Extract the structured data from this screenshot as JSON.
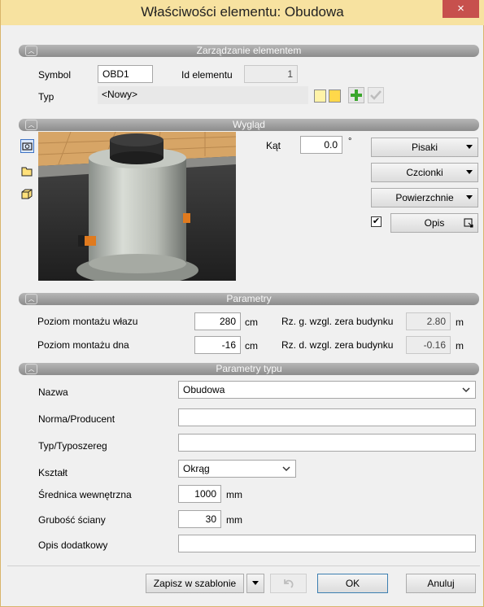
{
  "window": {
    "title": "Właściwości elementu: Obudowa",
    "close_glyph": "×"
  },
  "sections": {
    "management": "Zarządzanie elementem",
    "appearance": "Wygląd",
    "parameters": "Parametry",
    "type_parameters": "Parametry typu"
  },
  "management": {
    "symbol_label": "Symbol",
    "symbol_value": "OBD1",
    "id_label": "Id elementu",
    "id_value": "1",
    "type_label": "Typ",
    "type_value": "<Nowy>"
  },
  "appearance": {
    "angle_label": "Kąt",
    "angle_value": "0.0",
    "angle_unit": "°",
    "pens_label": "Pisaki",
    "fonts_label": "Czcionki",
    "surfaces_label": "Powierzchnie",
    "description_label": "Opis",
    "description_checked": true,
    "side_icons": [
      "camera-icon",
      "folder-icon",
      "cube-icon"
    ]
  },
  "parameters": {
    "top_label": "Poziom montażu włazu",
    "top_value": "280",
    "top_unit": "cm",
    "top_rel_label": "Rz. g. wzgl. zera budynku",
    "top_rel_value": "2.80",
    "top_rel_unit": "m",
    "bottom_label": "Poziom montażu dna",
    "bottom_value": "-16",
    "bottom_unit": "cm",
    "bottom_rel_label": "Rz. d. wzgl. zera budynku",
    "bottom_rel_value": "-0.16",
    "bottom_rel_unit": "m"
  },
  "type_params": {
    "name_label": "Nazwa",
    "name_value": "Obudowa",
    "norm_label": "Norma/Producent",
    "norm_value": "",
    "series_label": "Typ/Typoszereg",
    "series_value": "",
    "shape_label": "Kształt",
    "shape_value": "Okrąg",
    "diameter_label": "Średnica wewnętrzna",
    "diameter_value": "1000",
    "diameter_unit": "mm",
    "wall_label": "Grubość ściany",
    "wall_value": "30",
    "wall_unit": "mm",
    "extra_label": "Opis dodatkowy",
    "extra_value": ""
  },
  "footer": {
    "save_template_label": "Zapisz w szablonie",
    "ok_label": "OK",
    "cancel_label": "Anuluj"
  },
  "colors": {
    "accent": "#c7504d",
    "title_bar": "#f7e2a0",
    "section_bar": "#9e9e9e"
  }
}
